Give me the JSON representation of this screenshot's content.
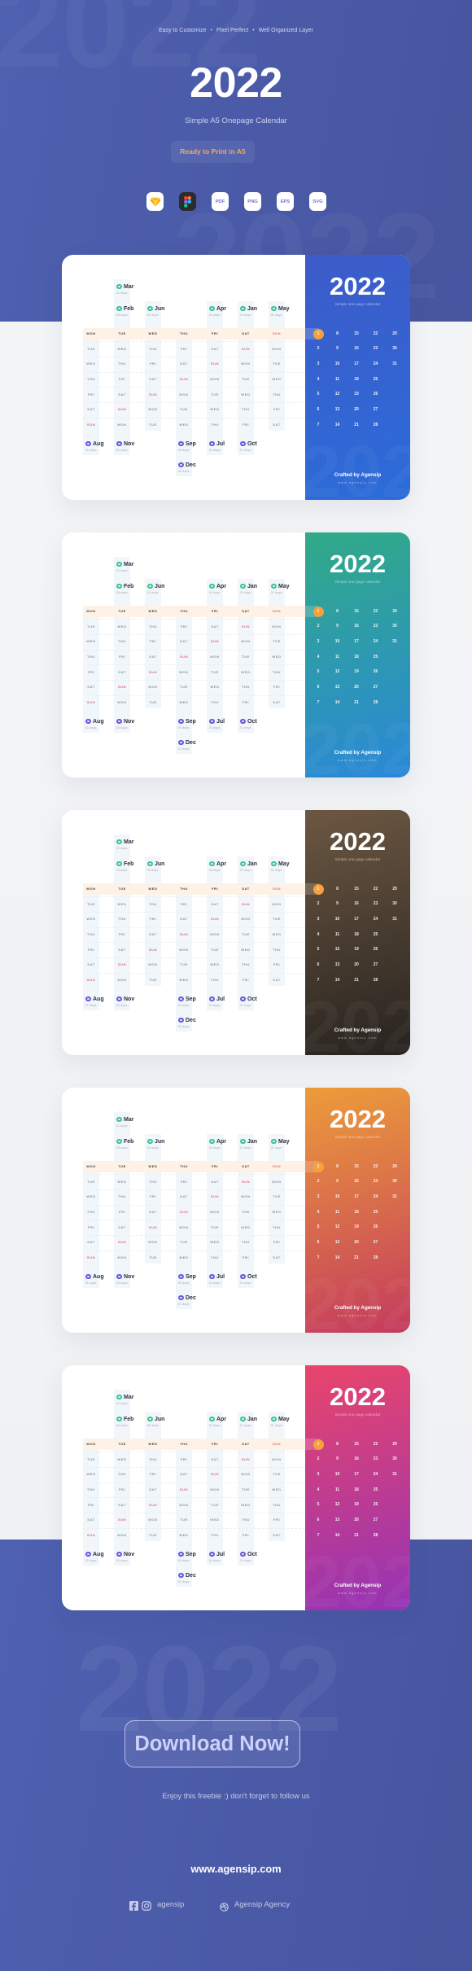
{
  "hero": {
    "taglines": [
      "Easy to Customize",
      "Pixel Perfect",
      "Well Organized Layer"
    ],
    "year": "2022",
    "subtitle": "Simple A5 Onepage Calendar",
    "badge": "Ready to Print in A5",
    "formats": [
      {
        "type": "sketch",
        "icon": "sketch-icon",
        "label": ""
      },
      {
        "type": "figma",
        "icon": "figma-icon",
        "label": ""
      },
      {
        "type": "file",
        "icon": "pdf-icon",
        "label": "PDF"
      },
      {
        "type": "file",
        "icon": "png-icon",
        "label": "PNG"
      },
      {
        "type": "file",
        "icon": "eps-icon",
        "label": "EPS"
      },
      {
        "type": "file",
        "icon": "svg-icon",
        "label": "SVG"
      }
    ]
  },
  "calendar": {
    "weekday_rows": [
      [
        "MON",
        "TUE",
        "WED",
        "THU",
        "FRI",
        "SAT",
        "SUN"
      ],
      [
        "TUE",
        "WED",
        "THU",
        "FRI",
        "SAT",
        "SUN",
        "MON"
      ],
      [
        "WED",
        "THU",
        "FRI",
        "SAT",
        "SUN",
        "MON",
        "TUE"
      ],
      [
        "THU",
        "FRI",
        "SAT",
        "SUN",
        "MON",
        "TUE",
        "WED"
      ],
      [
        "FRI",
        "SAT",
        "SUN",
        "MON",
        "TUE",
        "WED",
        "THU"
      ],
      [
        "SAT",
        "SUN",
        "MON",
        "TUE",
        "WED",
        "THU",
        "FRI"
      ],
      [
        "SUN",
        "MON",
        "TUE",
        "WED",
        "THU",
        "FRI",
        "SAT"
      ]
    ],
    "highlight_day": "SUN",
    "months": [
      {
        "name": "Jan",
        "days": "31 days",
        "starts_on": "SAT",
        "group": "first-half"
      },
      {
        "name": "Feb",
        "days": "28 days",
        "starts_on": "TUE",
        "group": "first-half"
      },
      {
        "name": "Mar",
        "days": "31 days",
        "starts_on": "TUE",
        "group": "first-half"
      },
      {
        "name": "Apr",
        "days": "30 days",
        "starts_on": "FRI",
        "group": "first-half"
      },
      {
        "name": "May",
        "days": "31 days",
        "starts_on": "SUN",
        "group": "first-half"
      },
      {
        "name": "Jun",
        "days": "30 days",
        "starts_on": "WED",
        "group": "first-half"
      },
      {
        "name": "Jul",
        "days": "31 days",
        "starts_on": "FRI",
        "group": "second-half"
      },
      {
        "name": "Aug",
        "days": "31 days",
        "starts_on": "MON",
        "group": "second-half"
      },
      {
        "name": "Sep",
        "days": "30 days",
        "starts_on": "THU",
        "group": "second-half"
      },
      {
        "name": "Oct",
        "days": "31 days",
        "starts_on": "SAT",
        "group": "second-half"
      },
      {
        "name": "Nov",
        "days": "30 days",
        "starts_on": "TUE",
        "group": "second-half"
      },
      {
        "name": "Dec",
        "days": "31 days",
        "starts_on": "THU",
        "group": "second-half"
      }
    ],
    "date_rows": [
      [
        "1",
        "8",
        "15",
        "22",
        "29"
      ],
      [
        "2",
        "9",
        "16",
        "23",
        "30"
      ],
      [
        "3",
        "10",
        "17",
        "24",
        "31"
      ],
      [
        "4",
        "11",
        "18",
        "25"
      ],
      [
        "5",
        "12",
        "19",
        "26"
      ],
      [
        "6",
        "13",
        "20",
        "27"
      ],
      [
        "7",
        "14",
        "21",
        "28"
      ]
    ],
    "highlighted_date": "1",
    "panel_year": "2022",
    "panel_subtitle": "Simple one page calendar",
    "credit": "Crafted by Agensip",
    "credit_url": "www.agensip.com"
  },
  "cards": [
    {
      "theme": "blue",
      "panel_colors": [
        "#3d5bc9",
        "#2b6cd9"
      ]
    },
    {
      "theme": "teal",
      "panel_colors": [
        "#31aa87",
        "#2a88d8"
      ]
    },
    {
      "theme": "brown",
      "panel_colors": [
        "#6c5742",
        "#27231f"
      ]
    },
    {
      "theme": "orange",
      "panel_colors": [
        "#ec9c3a",
        "#c43b5e"
      ]
    },
    {
      "theme": "magenta",
      "panel_colors": [
        "#e9456b",
        "#9533b5"
      ]
    }
  ],
  "colors": {
    "first_half_icon": "#3ec48f",
    "second_half_icon": "#6b5ad8",
    "today_circle": "#f6a13c",
    "sunday_text": "#e2677c",
    "background_blue": "#4b5ba9"
  },
  "cta": {
    "button": "Download Now!",
    "note": "Enjoy this freebie :) don't forget to follow us",
    "website": "www.agensip.com",
    "social_handle": "agensip",
    "dribbble_name": "Agensip Agency"
  }
}
